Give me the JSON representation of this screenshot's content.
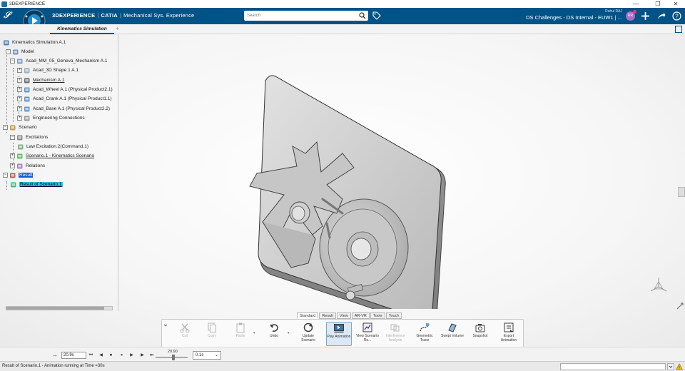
{
  "window": {
    "title": "3DEXPERIENCE",
    "controls": [
      "—",
      "❐",
      "✕"
    ]
  },
  "header": {
    "brand": "3DEXPERIENCE",
    "brand_sep": "|",
    "brand_product": "CATIA",
    "brand_sep2": "|",
    "app_name": "Mechanical Sys. Experience",
    "compass_version": "V.R",
    "search_placeholder": "Search",
    "user_name": "Rahul RAJ",
    "context": "DS Challenges - DS Internal - EUW1 | ...",
    "avatar_initials": "RR",
    "brand_color": "#005386"
  },
  "tabs": {
    "active": "Kinematics Simulation",
    "add": "+"
  },
  "tree": {
    "nodes": [
      {
        "label": "Kinematics Simulation A.1",
        "icon": "simulation-icon"
      },
      {
        "label": "Model",
        "icon": "model-icon"
      },
      {
        "label": "Acad_MM_05_Geneva_Mechanism A.1",
        "icon": "product-icon"
      },
      {
        "label": "Acad_3D Shape 1 A.1",
        "icon": "shape-icon"
      },
      {
        "label": "Mechanism A.1",
        "icon": "mechanism-icon"
      },
      {
        "label": "Acad_Wheel A.1 (Physical Product2.1)",
        "icon": "part-icon"
      },
      {
        "label": "Acad_Crank A.1 (Physical Product1.1)",
        "icon": "part-icon"
      },
      {
        "label": "Acad_Base A.1 (Physical Product2.2)",
        "icon": "part-icon"
      },
      {
        "label": "Engineering Connections",
        "icon": "connections-icon"
      },
      {
        "label": "Scenario",
        "icon": "scenario-icon"
      },
      {
        "label": "Excitations",
        "icon": "excitations-icon"
      },
      {
        "label": "Law Excitation.2(Command.1)",
        "icon": "law-icon"
      },
      {
        "label": "Scenario.1 - Kinematics Scenario",
        "icon": "scenario-item-icon"
      },
      {
        "label": "Relations",
        "icon": "relations-icon"
      },
      {
        "label": "Result",
        "icon": "result-icon"
      },
      {
        "label": "Result of Scenario.1",
        "icon": "result-item-icon"
      }
    ]
  },
  "section_tabs": [
    "Standard",
    "Result",
    "View",
    "AR-VR",
    "Tools",
    "Touch"
  ],
  "actions": [
    {
      "label": "Cut",
      "icon": "cut-icon",
      "enabled": false
    },
    {
      "label": "Copy",
      "icon": "copy-icon",
      "enabled": false
    },
    {
      "label": "Paste",
      "icon": "paste-icon",
      "enabled": false
    },
    {
      "label": "Undo",
      "icon": "undo-icon",
      "enabled": true
    },
    {
      "label": "Update Scenario",
      "icon": "update-scenario-icon",
      "enabled": true
    },
    {
      "label": "Play Animation",
      "icon": "play-animation-icon",
      "enabled": true,
      "active": true
    },
    {
      "label": "View Scenario Re...",
      "icon": "view-results-icon",
      "enabled": true
    },
    {
      "label": "Interference Analysis",
      "icon": "interference-icon",
      "enabled": false
    },
    {
      "label": "Geometric Trace",
      "icon": "geometric-trace-icon",
      "enabled": true
    },
    {
      "label": "Swept Volume",
      "icon": "swept-volume-icon",
      "enabled": true
    },
    {
      "label": "Snapshot",
      "icon": "snapshot-icon",
      "enabled": true
    },
    {
      "label": "Export Animation",
      "icon": "export-animation-icon",
      "enabled": true
    }
  ],
  "player": {
    "time_value": "20.9s",
    "slider_value": "20.90",
    "step": "0.1s",
    "buttons": [
      "⏮",
      "◀",
      "⏹",
      "⏸",
      "▶",
      "⏭"
    ]
  },
  "status": {
    "message": "Result of Scenario.1 - Animation running at Time =30s"
  }
}
